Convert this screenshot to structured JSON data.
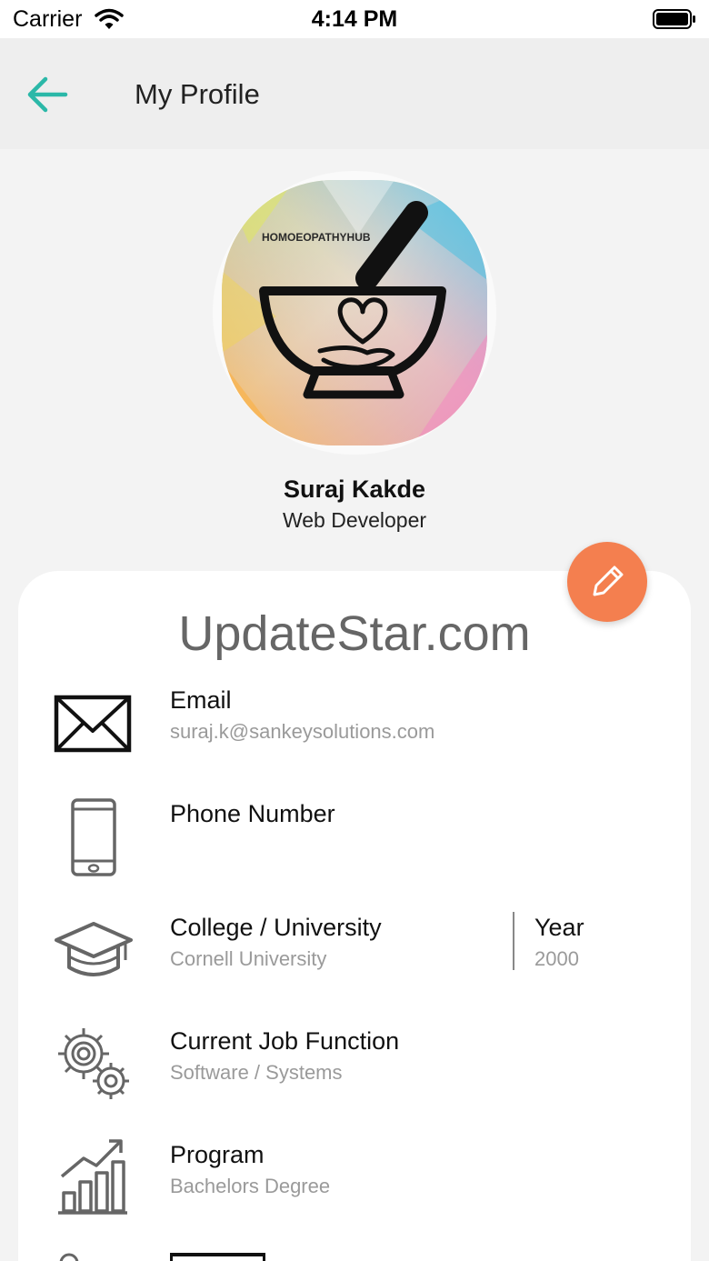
{
  "status_bar": {
    "carrier": "Carrier",
    "time": "4:14 PM"
  },
  "header": {
    "title": "My Profile"
  },
  "avatar": {
    "brand_text": "HOMOEOPATHYHUB"
  },
  "profile": {
    "name": "Suraj Kakde",
    "role": "Web Developer"
  },
  "watermark": "UpdateStar.com",
  "fields": {
    "email": {
      "label": "Email",
      "value": "suraj.k@sankeysolutions.com"
    },
    "phone": {
      "label": "Phone Number",
      "value": ""
    },
    "college": {
      "label": "College / University",
      "value": "Cornell University"
    },
    "year": {
      "label": "Year",
      "value": "2000"
    },
    "job": {
      "label": "Current Job Function",
      "value": "Software / Systems"
    },
    "program": {
      "label": "Program",
      "value": "Bachelors Degree"
    }
  },
  "colors": {
    "accent": "#2bb8a8",
    "fab": "#f47f4f",
    "value_text": "#9a9a9a"
  },
  "icons": [
    "wifi-icon",
    "battery-icon",
    "back-arrow-icon",
    "pencil-icon",
    "envelope-icon",
    "phone-icon",
    "graduation-cap-icon",
    "gears-icon",
    "growth-chart-icon",
    "location-pin-icon"
  ]
}
